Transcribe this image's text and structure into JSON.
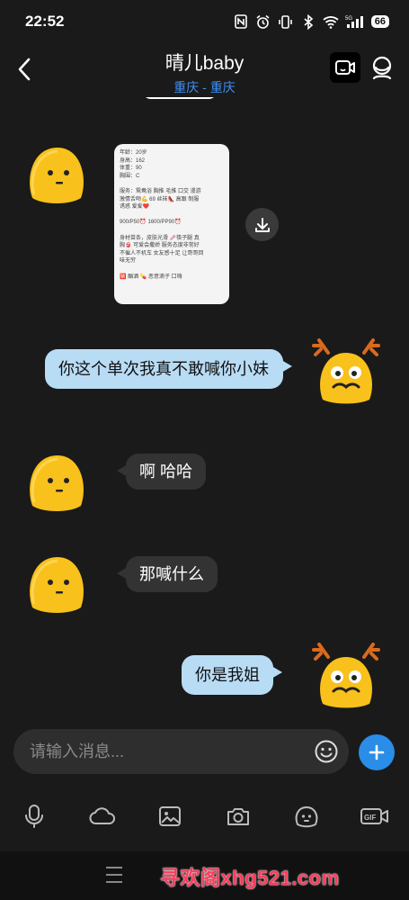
{
  "status_bar": {
    "time": "22:52",
    "battery": "66",
    "network": "5G"
  },
  "header": {
    "title": "晴儿baby",
    "location": "重庆 - 重庆"
  },
  "image_message": {
    "lines": [
      "年龄：20岁",
      "身高：162",
      "体重：90",
      "胸围：C",
      "",
      "服务：鸳鸯浴 胸推 毛推 口交 漫游",
      "激情舌吻💪 69 丝袜👠 高跟 制服",
      "诱惑 爱爱❤️",
      "",
      "900/P50⏰ 1600/PP90⏰",
      "",
      "身材苗条，皮肤光滑 🥢筷子腿 真",
      "胸👙 可爱会撒娇 服务态度非常好",
      "不催人不机车 女友感十足 让哥哥回",
      "味无穷",
      "",
      "🈲 酗酒 💊 恶意滴子 口嗨"
    ]
  },
  "messages": [
    {
      "side": "right",
      "text": "你这个单次我真不敢喊你小妹"
    },
    {
      "side": "left",
      "text": "啊 哈哈"
    },
    {
      "side": "left",
      "text": "那喊什么"
    },
    {
      "side": "right",
      "text": "你是我姐"
    }
  ],
  "composer": {
    "placeholder": "请输入消息..."
  },
  "toolbar": {
    "gif_label": "GIF"
  },
  "watermark": "寻欢阁xhg521.com",
  "colors": {
    "accent": "#2a8de8",
    "bubble_right": "#b9dcf5",
    "bubble_left": "#333333",
    "location": "#3f8ff0"
  }
}
